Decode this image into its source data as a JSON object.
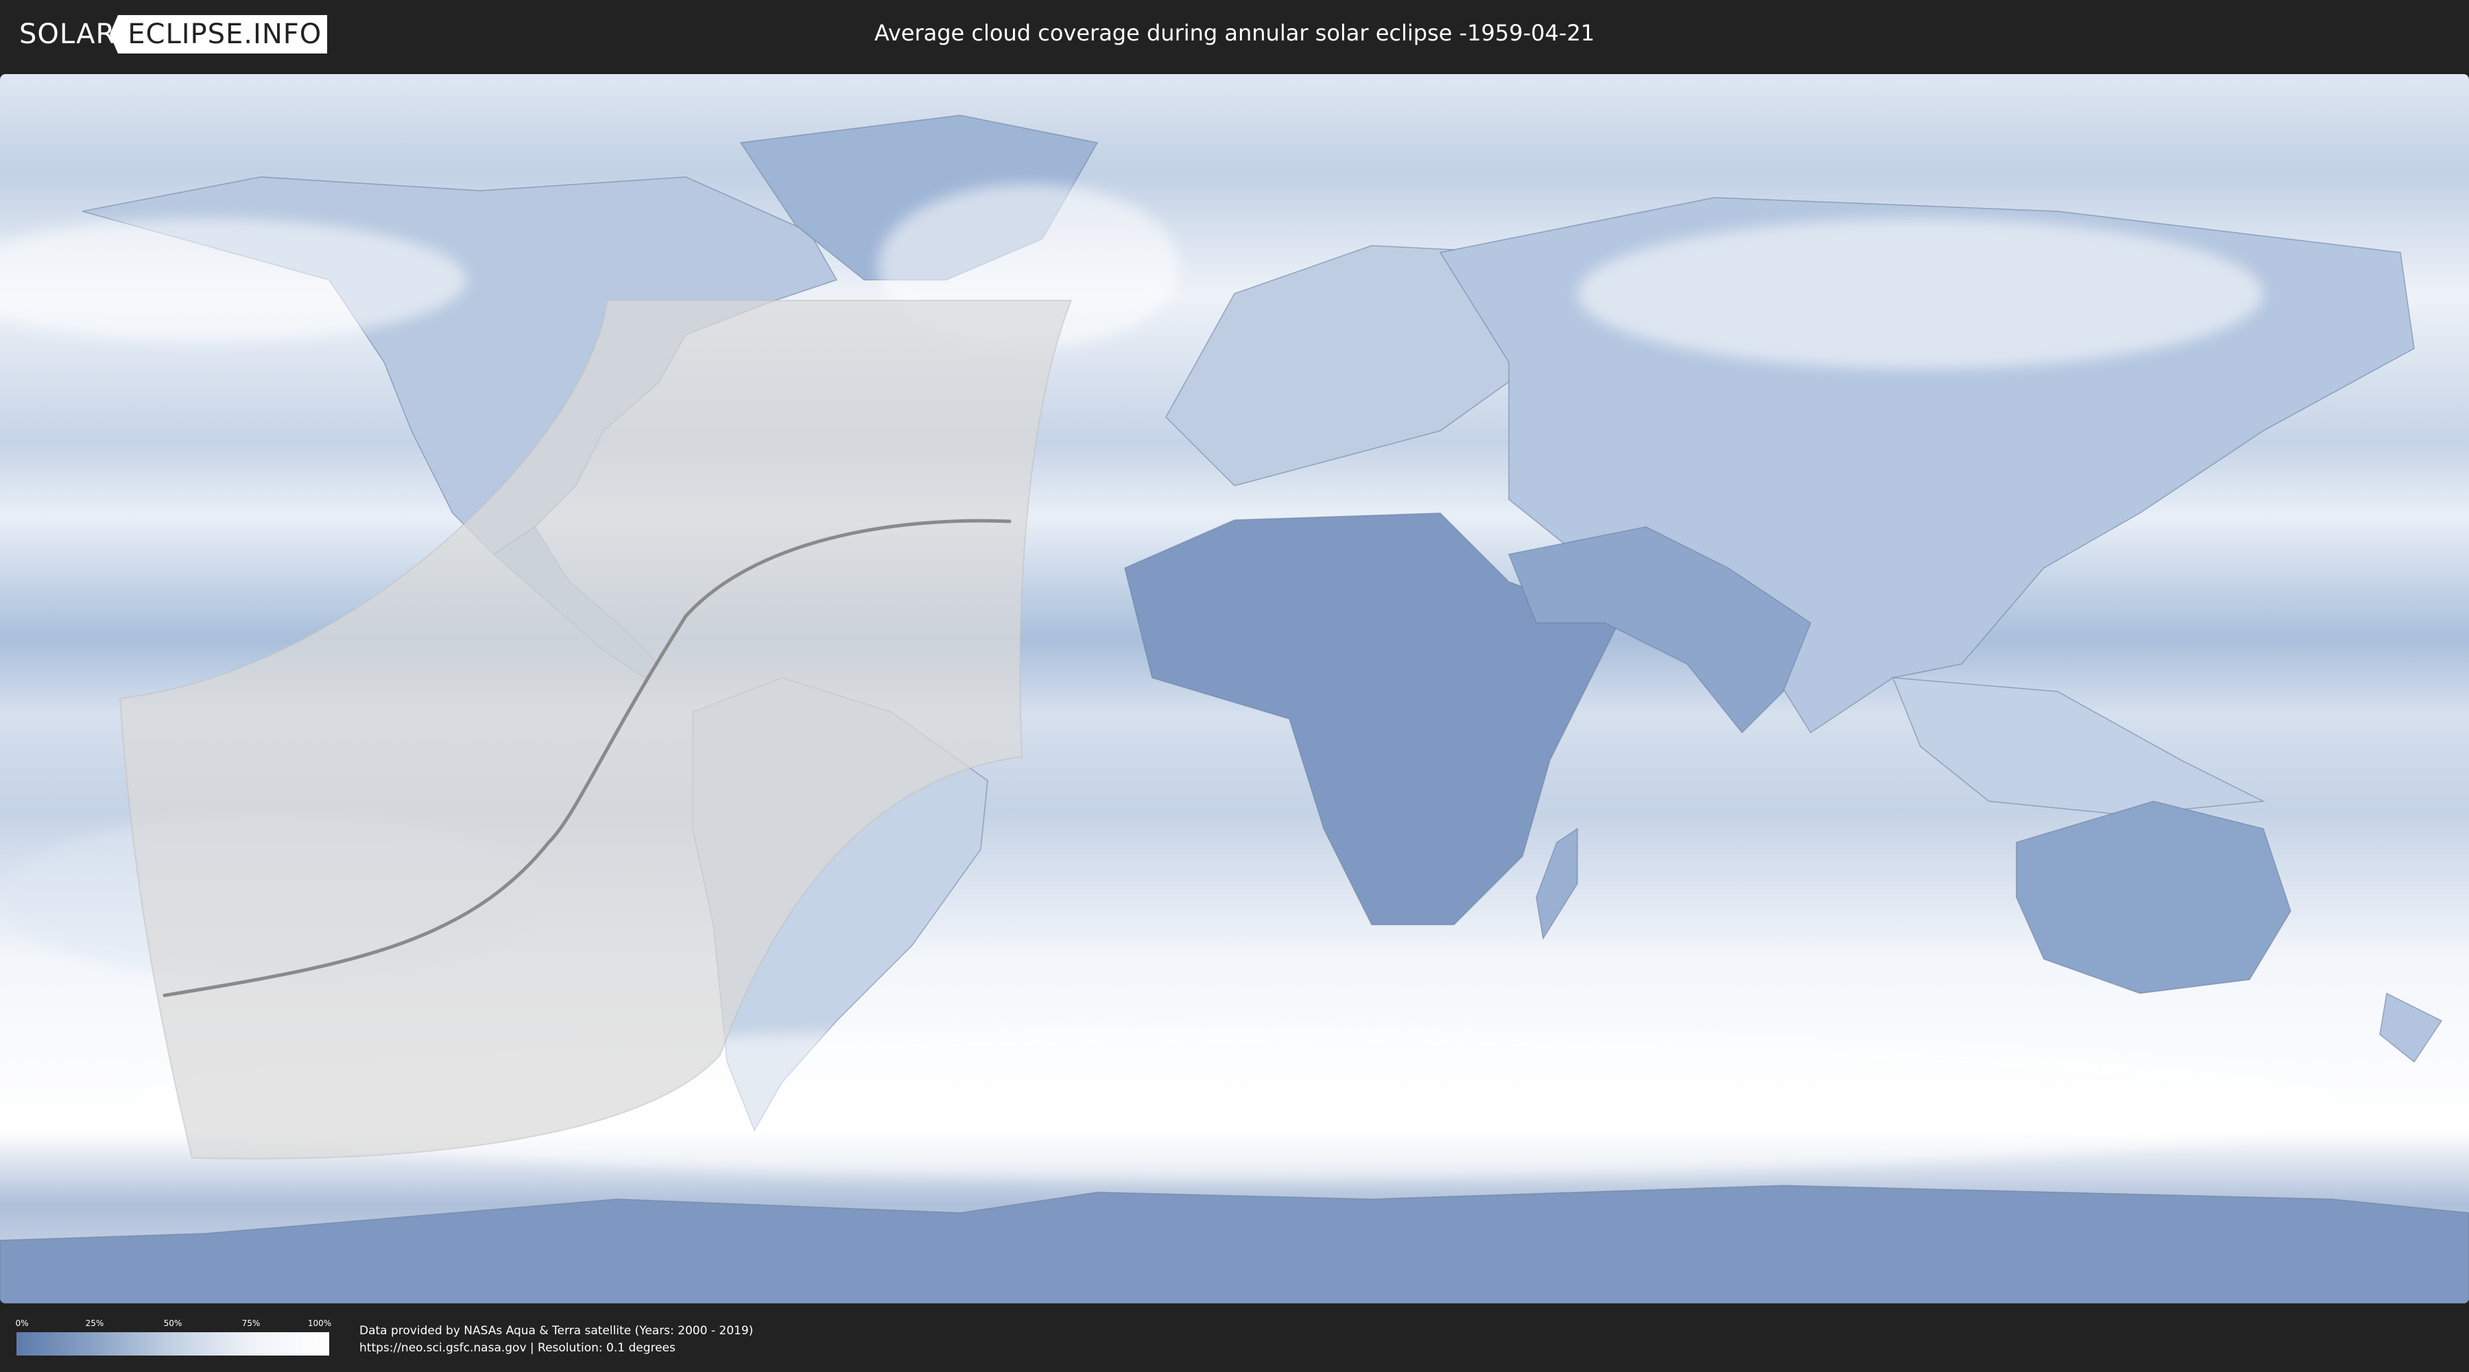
{
  "header": {
    "logo_left": "SOLAR",
    "logo_right": "ECLIPSE.INFO",
    "title": "Average cloud coverage during annular solar eclipse -1959-04-21"
  },
  "legend": {
    "ticks": [
      "0%",
      "25%",
      "50%",
      "75%",
      "100%"
    ],
    "tick_values": [
      0,
      25,
      50,
      75,
      100
    ],
    "colors": [
      "#5d7bab",
      "#8aa3c7",
      "#c3d1e4",
      "#eef2f8",
      "#ffffff"
    ]
  },
  "credits": {
    "line1": "Data provided by NASAs Aqua & Terra satellite (Years: 2000 - 2019)",
    "line2": "https://neo.sci.gsfc.nasa.gov | Resolution: 0.1 degrees"
  },
  "map": {
    "projection": "equirectangular",
    "colors": {
      "clear": "#6f8ab6",
      "cloudy": "#f6f8fc",
      "eclipse_zone": "#d9d9d9",
      "path": "#8a8a8a"
    }
  }
}
